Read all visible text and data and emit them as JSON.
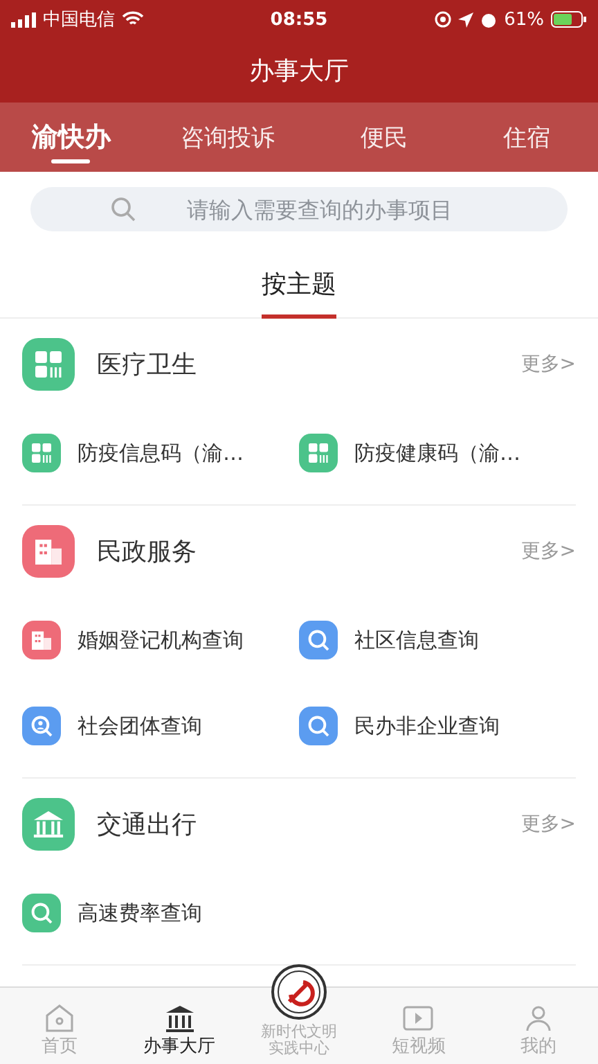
{
  "status_bar": {
    "carrier": "中国电信",
    "time": "08:55",
    "battery": "61%"
  },
  "header": {
    "title": "办事大厅"
  },
  "tabs": [
    {
      "label": "渝快办",
      "selected": true
    },
    {
      "label": "咨询投诉",
      "selected": false
    },
    {
      "label": "便民",
      "selected": false
    },
    {
      "label": "住宿",
      "selected": false
    }
  ],
  "search": {
    "placeholder": "请输入需要查询的办事项目"
  },
  "theme_tabs": [
    {
      "label": "按主题",
      "selected": true
    }
  ],
  "sections": [
    {
      "title": "医疗卫生",
      "more": "更多>",
      "color": "#4cc38a",
      "kind": "grid",
      "items": [
        {
          "label": "防疫信息码（渝…",
          "color": "#4cc38a",
          "kind": "grid"
        },
        {
          "label": "防疫健康码（渝…",
          "color": "#4cc38a",
          "kind": "grid"
        }
      ]
    },
    {
      "title": "民政服务",
      "more": "更多>",
      "color": "#ee6b78",
      "kind": "building",
      "items": [
        {
          "label": "婚姻登记机构查询",
          "color": "#ee6b78",
          "kind": "building"
        },
        {
          "label": "社区信息查询",
          "color": "#5b9cf0",
          "kind": "search"
        },
        {
          "label": "社会团体查询",
          "color": "#5b9cf0",
          "kind": "person"
        },
        {
          "label": "民办非企业查询",
          "color": "#5b9cf0",
          "kind": "search"
        }
      ]
    },
    {
      "title": "交通出行",
      "more": "更多>",
      "color": "#4cc38a",
      "kind": "bank",
      "items": [
        {
          "label": "高速费率查询",
          "color": "#4cc38a",
          "kind": "search"
        }
      ]
    }
  ],
  "bottom_nav": [
    {
      "label": "首页",
      "kind": "home",
      "selected": false
    },
    {
      "label": "办事大厅",
      "kind": "bank",
      "selected": true
    },
    {
      "label": "新时代文明实践中心",
      "kind": "emblem",
      "selected": false
    },
    {
      "label": "短视频",
      "kind": "play",
      "selected": false
    },
    {
      "label": "我的",
      "kind": "person",
      "selected": false
    }
  ]
}
